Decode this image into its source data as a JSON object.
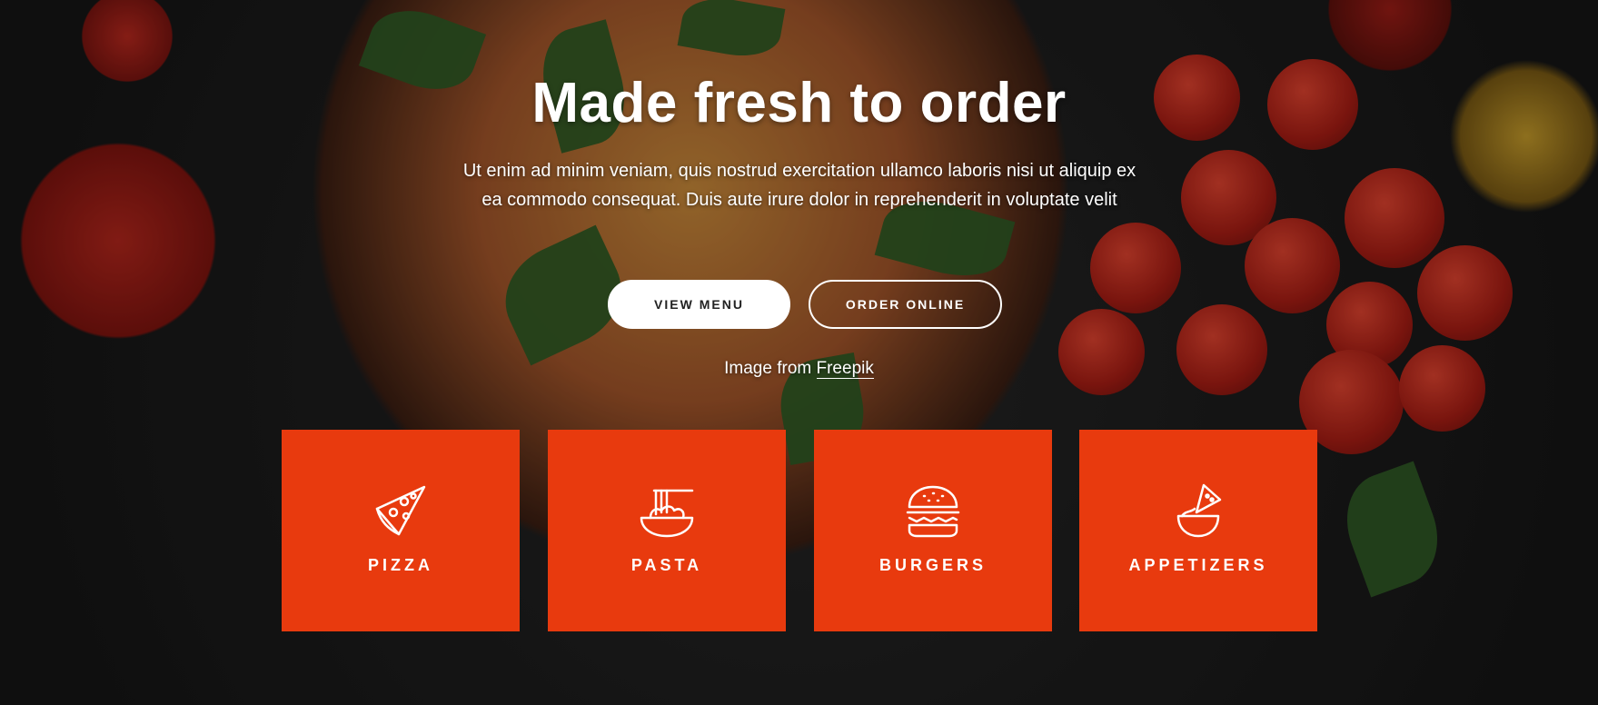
{
  "hero": {
    "title": "Made fresh to order",
    "lead": "Ut enim ad minim veniam, quis nostrud exercitation ullamco laboris nisi ut aliquip ex ea commodo consequat. Duis aute irure dolor in reprehenderit in voluptate velit",
    "buttons": {
      "view_menu": "VIEW MENU",
      "order_online": "ORDER ONLINE"
    },
    "credit": {
      "prefix": "Image from",
      "link": "Freepik"
    }
  },
  "categories": [
    {
      "label": "PIZZA",
      "icon": "pizza-slice-icon"
    },
    {
      "label": "PASTA",
      "icon": "pasta-bowl-icon"
    },
    {
      "label": "BURGERS",
      "icon": "burger-icon"
    },
    {
      "label": "APPETIZERS",
      "icon": "nacho-dip-icon"
    }
  ],
  "colors": {
    "tile_background": "#e83a0e",
    "text": "#ffffff",
    "button_primary_bg": "#ffffff"
  }
}
